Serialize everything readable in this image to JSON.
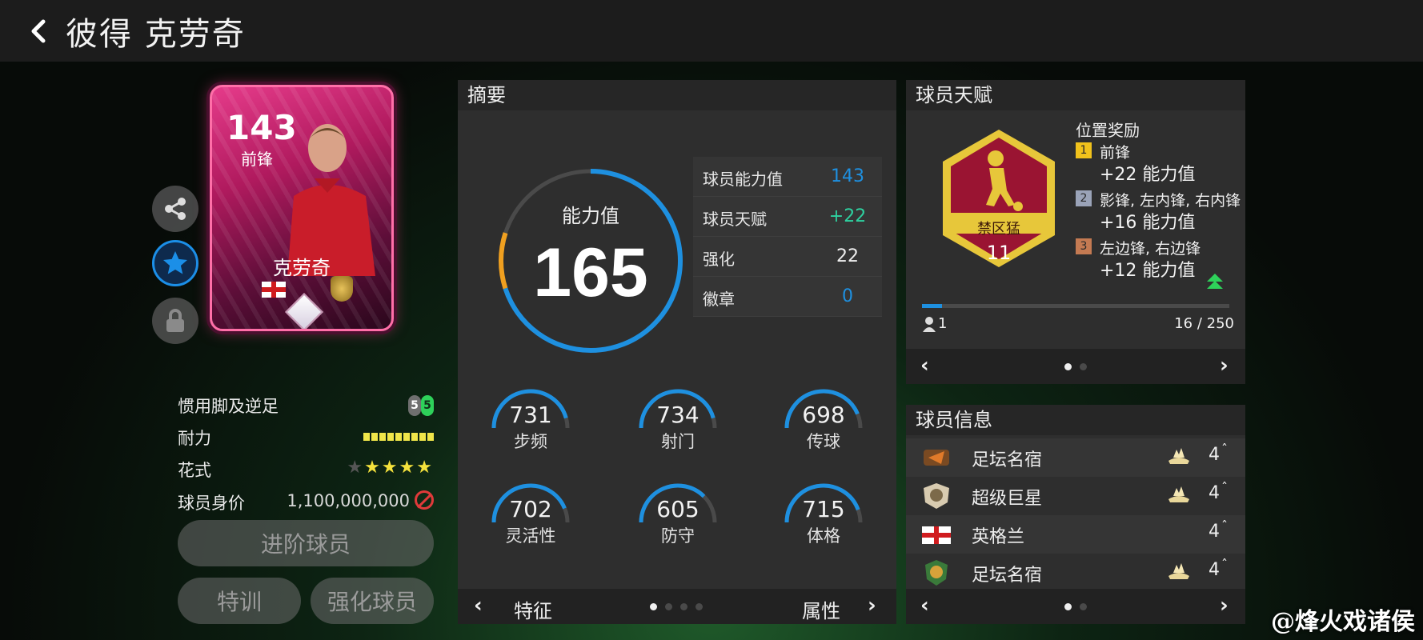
{
  "header": {
    "back_icon": "chevron-left-icon",
    "title": "彼得 克劳奇"
  },
  "player_card": {
    "rating": "143",
    "position": "前锋",
    "name": "克劳奇",
    "nation_flag": "england-flag",
    "colors": {
      "card_primary": "#e53b8a",
      "card_dark": "#2a071c"
    }
  },
  "side_actions": {
    "share_icon": "share-icon",
    "favorite_icon": "star-icon",
    "lock_icon": "lock-icon"
  },
  "attributes": {
    "foot": {
      "label": "惯用脚及逆足",
      "weak": "5",
      "strong": "5"
    },
    "stamina": {
      "label": "耐力",
      "segments": 9
    },
    "skill_moves": {
      "label": "花式",
      "stars_on": 4,
      "stars_total": 5
    },
    "value": {
      "label": "球员身价",
      "amount": "1,100,000,000"
    }
  },
  "buttons": {
    "upgrade": "进阶球员",
    "train": "特训",
    "enhance": "强化球员"
  },
  "summary": {
    "title": "摘要",
    "ovr_label": "能力值",
    "ovr_value": "165",
    "gauge_fraction": 0.8,
    "table": [
      {
        "key": "球员能力值",
        "value": "143",
        "color": "#1e90e0"
      },
      {
        "key": "球员天赋",
        "value": "+22",
        "color": "#2ed1a0"
      },
      {
        "key": "强化",
        "value": "22",
        "color": "#eeeeee"
      },
      {
        "key": "徽章",
        "value": "0",
        "color": "#1e90e0"
      }
    ],
    "stats": [
      {
        "value": "731",
        "label": "步频",
        "fraction": 0.73
      },
      {
        "value": "734",
        "label": "射门",
        "fraction": 0.73
      },
      {
        "value": "698",
        "label": "传球",
        "fraction": 0.7
      },
      {
        "value": "702",
        "label": "灵活性",
        "fraction": 0.7
      },
      {
        "value": "605",
        "label": "防守",
        "fraction": 0.6
      },
      {
        "value": "715",
        "label": "体格",
        "fraction": 0.71
      }
    ],
    "footer": {
      "left": "特征",
      "right": "属性",
      "page_count": 4,
      "current_page": 0
    }
  },
  "talent": {
    "title": "球员天赋",
    "badge_name": "禁区猛",
    "badge_level": "11",
    "bonus_title": "位置奖励",
    "bonuses": [
      {
        "rank": "1",
        "positions": "前锋",
        "bonus": "+22 能力值",
        "rank_color": "#f1c21c"
      },
      {
        "rank": "2",
        "positions": "影锋, 左内锋, 右内锋",
        "bonus": "+16 能力值",
        "rank_color": "#9aa3b8"
      },
      {
        "rank": "3",
        "positions": "左边锋, 右边锋",
        "bonus": "+12 能力值",
        "rank_color": "#c47a52"
      }
    ],
    "progress_fraction": 0.064,
    "owner_count": "1",
    "progress_text": "16 / 250",
    "page_count": 2,
    "current_page": 0
  },
  "player_info": {
    "title": "球员信息",
    "items": [
      {
        "icon": "legend-badge-icon",
        "text": "足坛名宿",
        "level": "4",
        "boost": true
      },
      {
        "icon": "superstar-badge-icon",
        "text": "超级巨星",
        "level": "4",
        "boost": true
      },
      {
        "icon": "england-flag-icon",
        "text": "英格兰",
        "level": "4",
        "boost": false
      },
      {
        "icon": "club-legend-badge-icon",
        "text": "足坛名宿",
        "level": "4",
        "boost": true
      }
    ],
    "page_count": 2,
    "current_page": 0
  },
  "watermark": "@烽火戏诸侯"
}
